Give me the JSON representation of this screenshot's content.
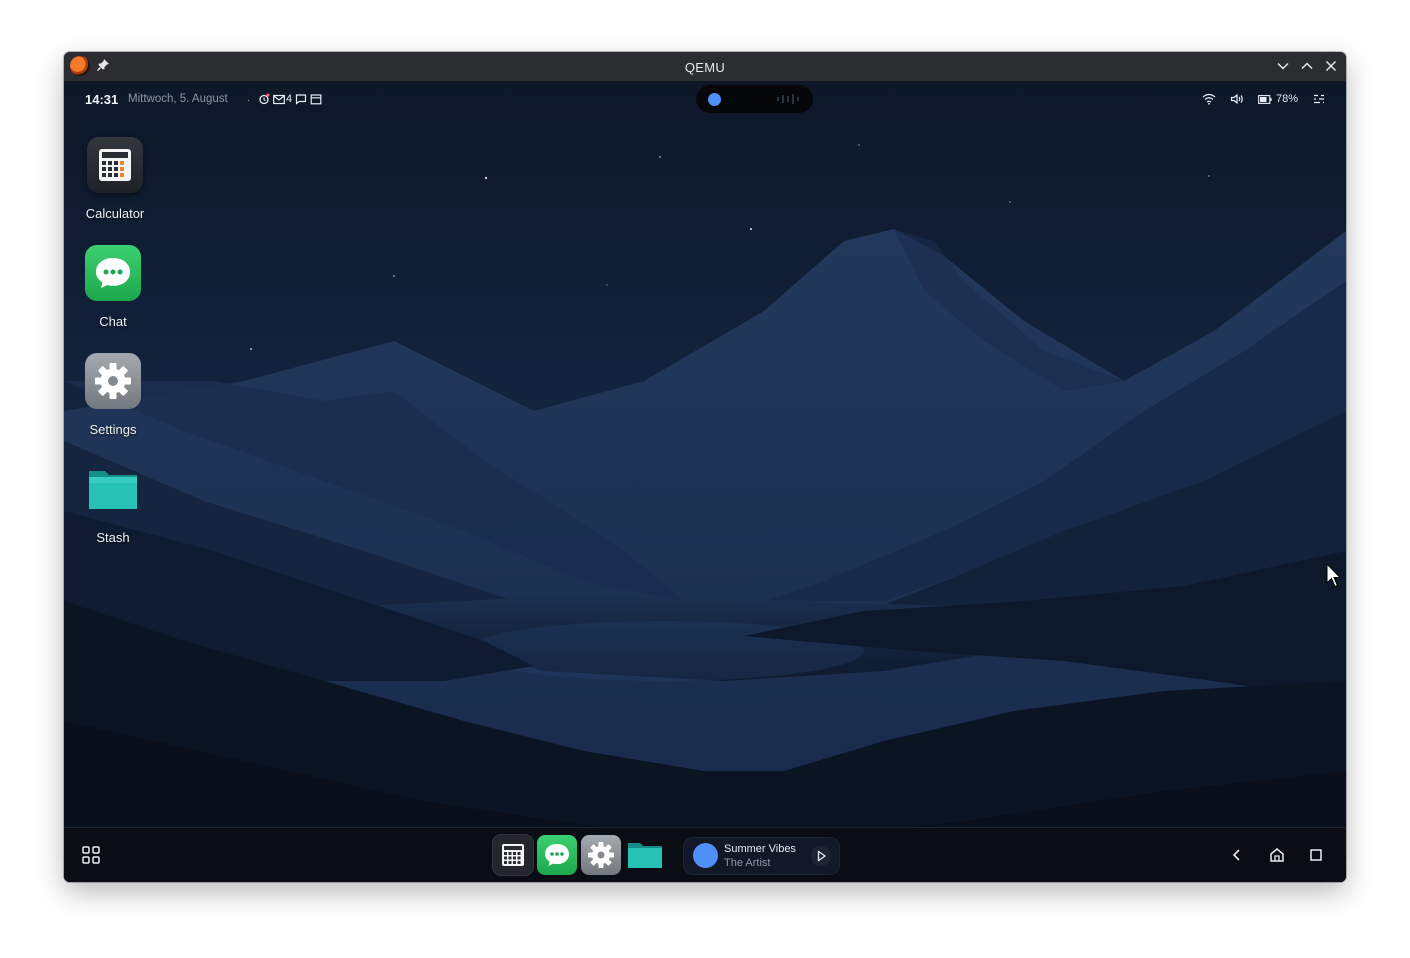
{
  "window": {
    "title": "QEMU"
  },
  "status_bar": {
    "time": "14:31",
    "date": "Mittwoch, 5. August",
    "separator": ".",
    "notification_icons": [
      "alarm-icon",
      "mail-icon",
      "sms-icon",
      "calendar-icon"
    ],
    "mail_count": "4",
    "battery_percent": "78%",
    "right_icons": [
      "wifi-icon",
      "volume-icon",
      "battery-icon",
      "quick-settings-icon"
    ]
  },
  "desktop": {
    "icons": [
      {
        "label": "Calculator",
        "icon": "calculator-icon",
        "color": "#2a2d33"
      },
      {
        "label": "Chat",
        "icon": "chat-icon",
        "color": "#22b45a"
      },
      {
        "label": "Settings",
        "icon": "settings-gear-icon",
        "color": "#8d9299"
      },
      {
        "label": "Stash",
        "icon": "folder-icon",
        "color": "#1fb5ab"
      }
    ]
  },
  "taskbar": {
    "dock_apps": [
      "Calculator",
      "Chat",
      "Settings",
      "Stash"
    ],
    "media": {
      "title": "Summer Vibes",
      "artist": "The Artist",
      "accent": "#4f8ff7"
    },
    "nav": [
      "back-icon",
      "home-icon",
      "recents-icon"
    ]
  },
  "colors": {
    "accent": "#4f8ff7",
    "titlebar": "#2b2d31",
    "taskbar": "#0a0d14"
  }
}
